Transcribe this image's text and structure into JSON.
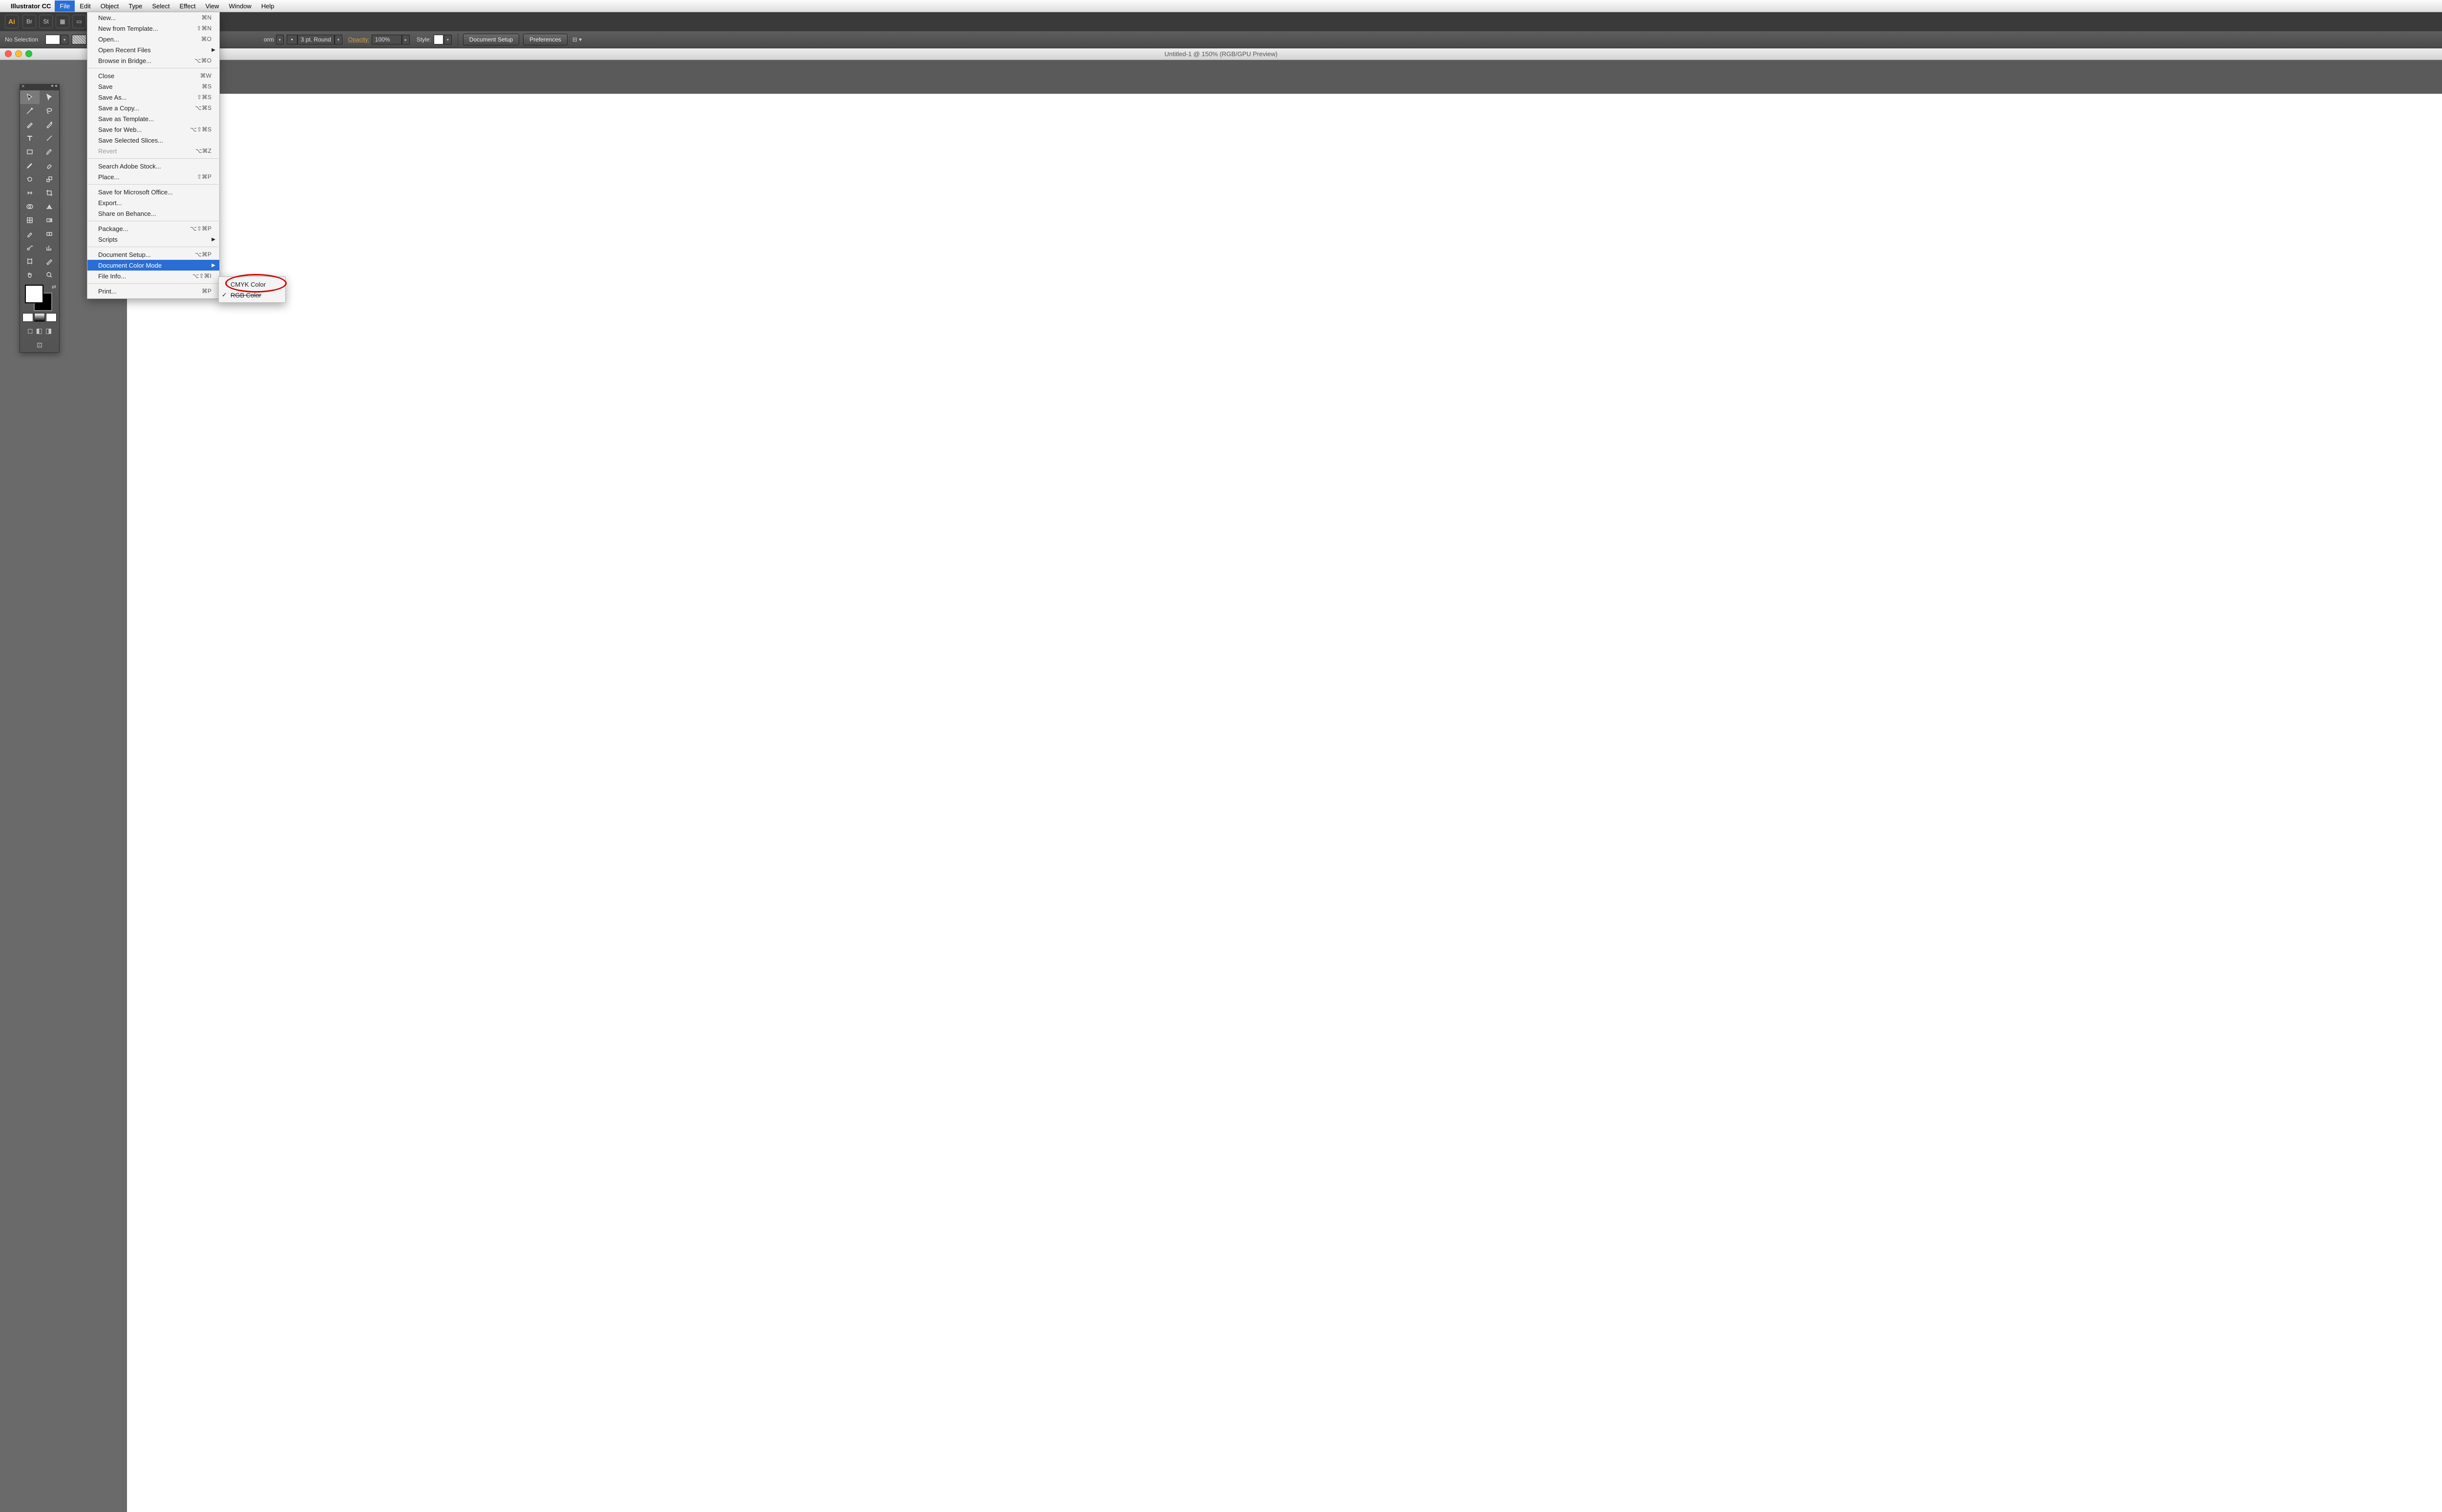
{
  "menubar": {
    "app": "Illustrator CC",
    "items": [
      "File",
      "Edit",
      "Object",
      "Type",
      "Select",
      "Effect",
      "View",
      "Window",
      "Help"
    ],
    "active": "File"
  },
  "appbar": {
    "logo": "Ai",
    "icons": [
      "Br",
      "St",
      "▦",
      "▭"
    ]
  },
  "controlbar": {
    "selection": "No Selection",
    "stroke_form_label": "orm",
    "stroke_value": "3 pt. Round",
    "opacity_label": "Opacity:",
    "opacity_value": "100%",
    "style_label": "Style:",
    "doc_setup": "Document Setup",
    "preferences": "Preferences"
  },
  "doc": {
    "title": "Untitled-1 @ 150% (RGB/GPU Preview)"
  },
  "file_menu": [
    {
      "label": "New...",
      "sc": "⌘N"
    },
    {
      "label": "New from Template...",
      "sc": "⇧⌘N"
    },
    {
      "label": "Open...",
      "sc": "⌘O"
    },
    {
      "label": "Open Recent Files",
      "sub": true
    },
    {
      "label": "Browse in Bridge...",
      "sc": "⌥⌘O"
    },
    {
      "sep": true
    },
    {
      "label": "Close",
      "sc": "⌘W"
    },
    {
      "label": "Save",
      "sc": "⌘S"
    },
    {
      "label": "Save As...",
      "sc": "⇧⌘S"
    },
    {
      "label": "Save a Copy...",
      "sc": "⌥⌘S"
    },
    {
      "label": "Save as Template..."
    },
    {
      "label": "Save for Web...",
      "sc": "⌥⇧⌘S"
    },
    {
      "label": "Save Selected Slices..."
    },
    {
      "label": "Revert",
      "sc": "⌥⌘Z",
      "disabled": true
    },
    {
      "sep": true
    },
    {
      "label": "Search Adobe Stock..."
    },
    {
      "label": "Place...",
      "sc": "⇧⌘P"
    },
    {
      "sep": true
    },
    {
      "label": "Save for Microsoft Office..."
    },
    {
      "label": "Export..."
    },
    {
      "label": "Share on Behance..."
    },
    {
      "sep": true
    },
    {
      "label": "Package...",
      "sc": "⌥⇧⌘P"
    },
    {
      "label": "Scripts",
      "sub": true
    },
    {
      "sep": true
    },
    {
      "label": "Document Setup...",
      "sc": "⌥⌘P"
    },
    {
      "label": "Document Color Mode",
      "sub": true,
      "hover": true
    },
    {
      "label": "File Info...",
      "sc": "⌥⇧⌘I"
    },
    {
      "sep": true
    },
    {
      "label": "Print...",
      "sc": "⌘P"
    }
  ],
  "color_mode_submenu": [
    {
      "label": "CMYK Color"
    },
    {
      "label": "RGB Color",
      "checked": true,
      "strike": true
    }
  ],
  "tools": [
    "selection",
    "direct-selection",
    "magic-wand",
    "lasso",
    "pen",
    "curvature",
    "type",
    "line",
    "rectangle",
    "paintbrush",
    "pencil",
    "eraser",
    "rotate",
    "scale",
    "width",
    "free-transform",
    "shape-builder",
    "perspective-grid",
    "mesh",
    "gradient",
    "eyedropper",
    "blend",
    "symbol-sprayer",
    "column-graph",
    "artboard",
    "slice",
    "hand",
    "zoom"
  ]
}
